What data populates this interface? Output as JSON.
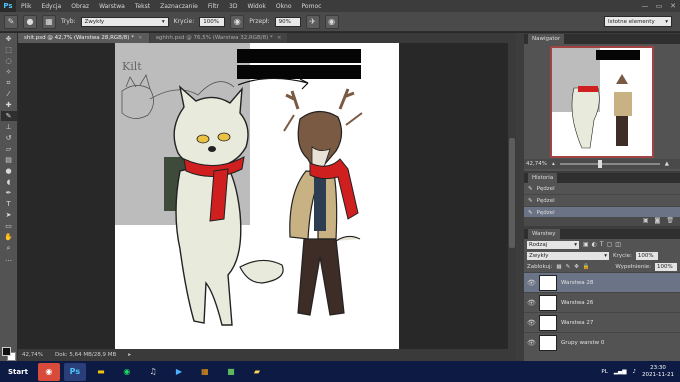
{
  "app": {
    "logo": "Ps"
  },
  "menu": [
    "Plik",
    "Edycja",
    "Obraz",
    "Warstwa",
    "Tekst",
    "Zaznaczanie",
    "Filtr",
    "3D",
    "Widok",
    "Okno",
    "Pomoc"
  ],
  "window_controls": {
    "minimize": "—",
    "restore": "▭",
    "close": "✕"
  },
  "options": {
    "mode_label": "Tryb:",
    "mode_value": "Zwykły",
    "opacity_label": "Krycie:",
    "opacity_value": "100%",
    "flow_label": "Przepł:",
    "flow_value": "90%",
    "workspace": "Istotne elementy"
  },
  "tabs": [
    {
      "label": "shit.psd @ 42,7% (Warstwa 28,RGB/8) *",
      "active": true
    },
    {
      "label": "aghhh.psd @ 76,5% (Warstwa 32,RGB/8) *",
      "active": false
    }
  ],
  "status": {
    "zoom": "42,74%",
    "doc": "Dok: 5,64 MB/28,9 MB"
  },
  "canvas": {
    "sketch_label": "Kilt"
  },
  "navigator": {
    "title": "Nawigator",
    "zoom": "42,74%"
  },
  "history": {
    "title": "Historia",
    "items": [
      {
        "label": "Pędzel",
        "active": false
      },
      {
        "label": "Pędzel",
        "active": false
      },
      {
        "label": "Pędzel",
        "active": false
      },
      {
        "label": "Pędzel",
        "active": true
      }
    ]
  },
  "layers": {
    "title": "Warstwy",
    "kind_label": "Rodzaj",
    "blend": "Zwykły",
    "opacity_label": "Krycie:",
    "opacity": "100%",
    "lock_label": "Zablokuj:",
    "fill_label": "Wypełnienie:",
    "fill": "100%",
    "items": [
      {
        "name": "Warstwa 28",
        "active": true
      },
      {
        "name": "Warstwa 26",
        "active": false
      },
      {
        "name": "Warstwa 27",
        "active": false
      },
      {
        "name": "Grupy warstw 0",
        "active": false
      }
    ]
  },
  "taskbar": {
    "start": "Start",
    "time": "23:30",
    "date": "2021-11-21",
    "lang": "PL"
  },
  "colors": {
    "scarf": "#cf1f1f",
    "wolf": "#e8ebdc",
    "deer_coat": "#c8b283",
    "deer_body": "#7a5a43"
  }
}
